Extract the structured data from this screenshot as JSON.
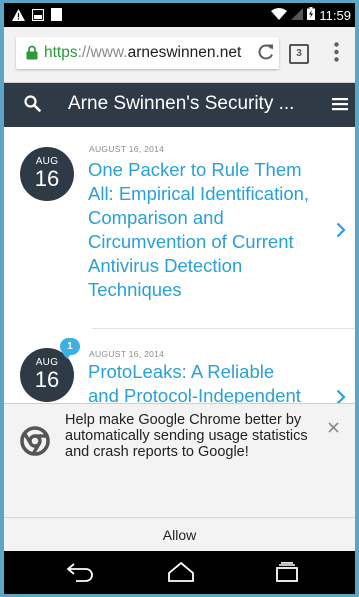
{
  "status_bar": {
    "time": "11:59",
    "left_icons": [
      "warning-icon",
      "image-icon",
      "storage-icon"
    ],
    "right_icons": [
      "wifi-icon",
      "signal-icon",
      "battery-icon"
    ]
  },
  "browser": {
    "url_scheme": "https",
    "url_separator": "://",
    "url_subdomain": "www.",
    "url_domain": "arneswinnen.net",
    "tab_count": "3"
  },
  "site": {
    "title": "Arne Swinnen's Security ..."
  },
  "posts": [
    {
      "month": "AUG",
      "day": "16",
      "date": "AUGUST 16, 2014",
      "title": "One Packer to Rule Them All: Empirical Identification, Comparison and Circumvention of Current Antivirus Detection Techniques"
    },
    {
      "month": "AUG",
      "day": "16",
      "date": "AUGUST 16, 2014",
      "title": "ProtoLeaks: A Reliable and Protocol-Independent Network Covert Channel",
      "comments": "1"
    }
  ],
  "infobar": {
    "message": "Help make Google Chrome better by automatically sending usage statistics and crash reports to Google!",
    "allow_label": "Allow"
  },
  "colors": {
    "accent_link": "#29a0d6",
    "header_bg": "#2e3a45",
    "secure_green": "#2c9a3b",
    "badge": "#3ab0e6"
  }
}
